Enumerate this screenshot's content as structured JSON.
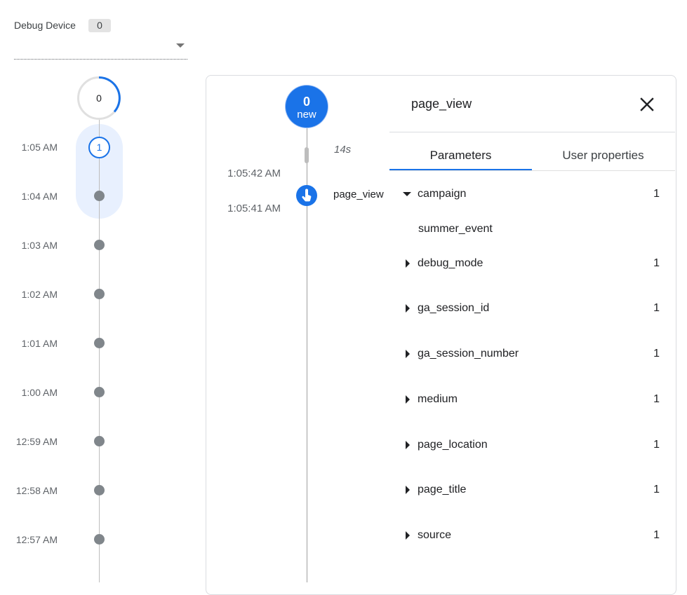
{
  "device": {
    "label": "Debug Device",
    "count": "0"
  },
  "minutes": {
    "top_count": "0",
    "active_count": "1",
    "times": [
      "1:05 AM",
      "1:04 AM",
      "1:03 AM",
      "1:02 AM",
      "1:01 AM",
      "1:00 AM",
      "12:59 AM",
      "12:58 AM",
      "12:57 AM"
    ]
  },
  "seconds": {
    "new_count": "0",
    "new_label": "new",
    "gap_label": "14s",
    "times": [
      "1:05:42 AM",
      "1:05:41 AM"
    ],
    "event_name": "page_view",
    "event_icon": "touch-icon"
  },
  "detail": {
    "title": "page_view",
    "close_icon": "close-icon",
    "tabs": [
      {
        "label": "Parameters",
        "active": true
      },
      {
        "label": "User properties",
        "active": false
      }
    ],
    "parameters": [
      {
        "name": "campaign",
        "count": "1",
        "expanded": true,
        "value": "summer_event"
      },
      {
        "name": "debug_mode",
        "count": "1",
        "expanded": false
      },
      {
        "name": "ga_session_id",
        "count": "1",
        "expanded": false
      },
      {
        "name": "ga_session_number",
        "count": "1",
        "expanded": false
      },
      {
        "name": "medium",
        "count": "1",
        "expanded": false
      },
      {
        "name": "page_location",
        "count": "1",
        "expanded": false
      },
      {
        "name": "page_title",
        "count": "1",
        "expanded": false
      },
      {
        "name": "source",
        "count": "1",
        "expanded": false
      }
    ]
  },
  "colors": {
    "accent": "#1a73e8",
    "dot": "#80868b",
    "highlight": "#e8f0fe"
  }
}
